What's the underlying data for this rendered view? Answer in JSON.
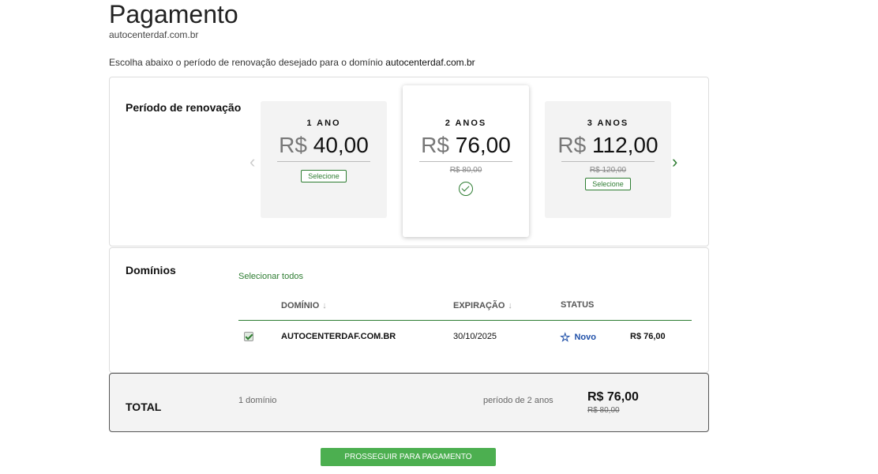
{
  "header": {
    "title": "Pagamento",
    "domain": "autocenterdaf.com.br",
    "intro_text": "Escolha abaixo o período de renovação desejado para o domínio",
    "intro_domain": "autocenterdaf.com.br"
  },
  "period": {
    "title": "Período de renovação",
    "plans": [
      {
        "years": "1 ANO",
        "currency": "R$",
        "price": "40,00",
        "old_price": "",
        "button": "Selecione"
      },
      {
        "years": "2 ANOS",
        "currency": "R$",
        "price": "76,00",
        "old_price": "R$ 80,00",
        "selected": true
      },
      {
        "years": "3 ANOS",
        "currency": "R$",
        "price": "112,00",
        "old_price": "R$ 120,00",
        "button": "Selecione"
      }
    ],
    "arrow_left": "‹",
    "arrow_right": "›"
  },
  "domains": {
    "title": "Domínios",
    "select_all": "Selecionar todos",
    "columns": {
      "domain": "DOMÍNIO",
      "expiration": "EXPIRAÇÃO",
      "status": "STATUS",
      "sort_icon": "↓"
    },
    "rows": [
      {
        "domain": "AUTOCENTERDAF.COM.BR",
        "expiration": "30/10/2025",
        "status": "Novo",
        "price": "R$ 76,00",
        "checked": true
      }
    ]
  },
  "total": {
    "label": "TOTAL",
    "count": "1 domínio",
    "period": "período de 2 anos",
    "price": "R$ 76,00",
    "old_price": "R$ 80,00"
  },
  "cta": {
    "label": "PROSSEGUIR PARA PAGAMENTO"
  },
  "colors": {
    "accent": "#2e7d32",
    "button": "#4caf50",
    "status": "#1e4fa8"
  }
}
